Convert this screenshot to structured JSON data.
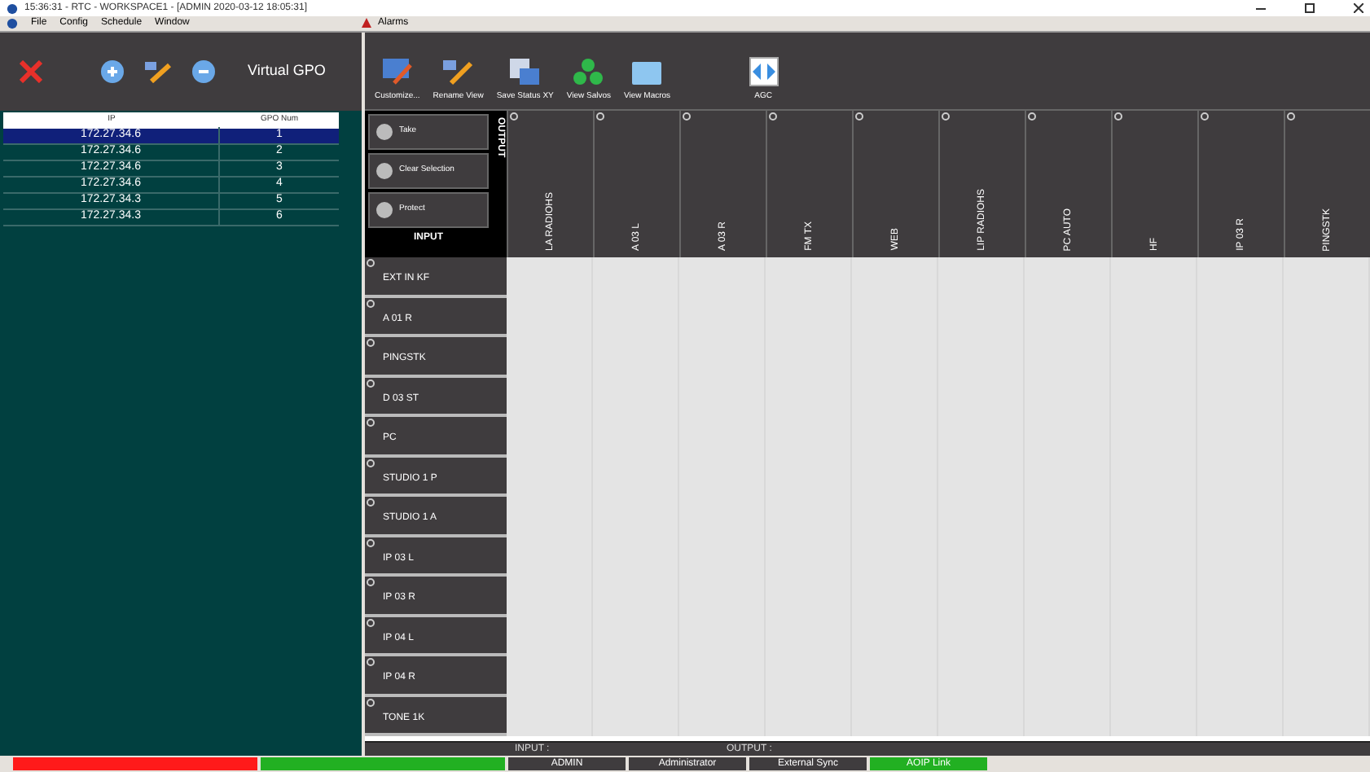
{
  "window": {
    "title": "15:36:31  - RTC - WORKSPACE1 - [ADMIN 2020-03-12 18:05:31]"
  },
  "menu": [
    "File",
    "Config",
    "Schedule",
    "Window"
  ],
  "alarms": "Alarms",
  "left_toolbar": {
    "title": "Virtual GPO"
  },
  "gpo_table": {
    "columns": [
      "IP",
      "GPO Num"
    ],
    "rows": [
      {
        "ip": "172.27.34.6",
        "num": "1",
        "selected": true
      },
      {
        "ip": "172.27.34.6",
        "num": "2",
        "selected": false
      },
      {
        "ip": "172.27.34.6",
        "num": "3",
        "selected": false
      },
      {
        "ip": "172.27.34.6",
        "num": "4",
        "selected": false
      },
      {
        "ip": "172.27.34.3",
        "num": "5",
        "selected": false
      },
      {
        "ip": "172.27.34.3",
        "num": "6",
        "selected": false
      }
    ]
  },
  "toolbar": [
    {
      "label": "Customize...",
      "kind": "customize"
    },
    {
      "label": "Rename View",
      "kind": "rename"
    },
    {
      "label": "Save Status XY",
      "kind": "save"
    },
    {
      "label": "View Salvos",
      "kind": "salvos"
    },
    {
      "label": "View Macros",
      "kind": "macros"
    },
    {
      "label": "AGC",
      "kind": "agc"
    }
  ],
  "actions": [
    "Take",
    "Clear Selection",
    "Protect"
  ],
  "output_label": "OUTPUT",
  "input_label": "INPUT",
  "outputs": [
    "LA RADIOHS",
    "A 03 L",
    "A 03 R",
    "FM TX",
    "WEB",
    "LIP RADIOHS",
    "PC AUTO",
    "HF",
    "IP 03 R",
    "PINGSTK"
  ],
  "inputs": [
    "EXT IN KF",
    "A 01 R",
    "PINGSTK",
    "D 03 ST",
    "PC",
    "STUDIO 1 P",
    "STUDIO 1 A",
    "IP 03 L",
    "IP 03 R",
    "IP 04 L",
    "IP 04 R",
    "TONE 1K"
  ],
  "info_bar": {
    "input": "INPUT :",
    "output": "OUTPUT :"
  },
  "status_bar": [
    {
      "color": "#ff1a1a"
    },
    {
      "color": "#22b022"
    },
    {
      "text": "ADMIN",
      "color": "#3f3c3e"
    },
    {
      "text": "Administrator",
      "color": "#3f3c3e"
    },
    {
      "text": "External Sync",
      "color": "#3f3c3e"
    },
    {
      "text": "AOIP Link",
      "color": "#22b022"
    }
  ]
}
